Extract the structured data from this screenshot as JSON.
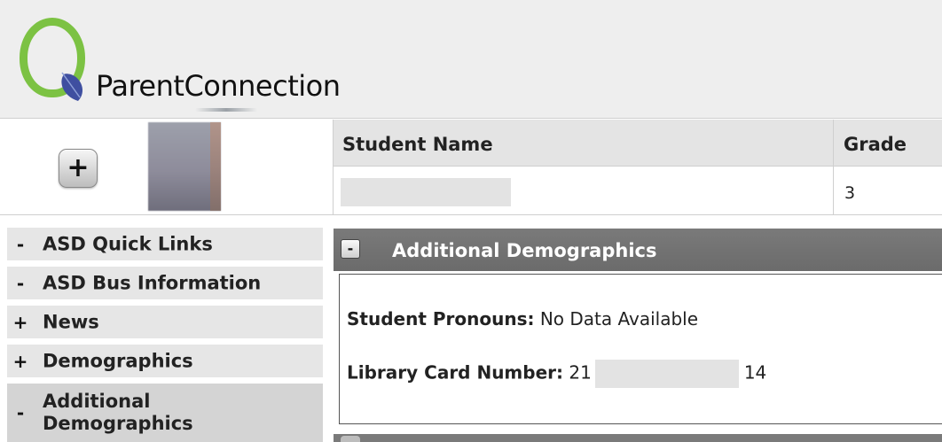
{
  "header": {
    "logo_text": "ParentConnection"
  },
  "student": {
    "expand_label": "+",
    "table": {
      "headers": [
        "Student Name",
        "Grade"
      ],
      "grade": "3"
    }
  },
  "sidebar": {
    "items": [
      {
        "toggle": "-",
        "label": "ASD Quick Links"
      },
      {
        "toggle": "-",
        "label": "ASD Bus Information"
      },
      {
        "toggle": "+",
        "label": "News"
      },
      {
        "toggle": "+",
        "label": "Demographics"
      },
      {
        "toggle": "-",
        "label": "Additional Demographics"
      }
    ]
  },
  "panel": {
    "toggle": "-",
    "title": "Additional Demographics",
    "fields": [
      {
        "label": "Student Pronouns:",
        "value": "No Data Available"
      },
      {
        "label": "Library Card Number:",
        "value_prefix": "21",
        "value_suffix": "14"
      }
    ]
  },
  "colors": {
    "brand_green": "#7cc243",
    "leaf_blue": "#3f4fa0",
    "panel_header": "#727272",
    "sidebar_bg": "#e6e6e6"
  }
}
